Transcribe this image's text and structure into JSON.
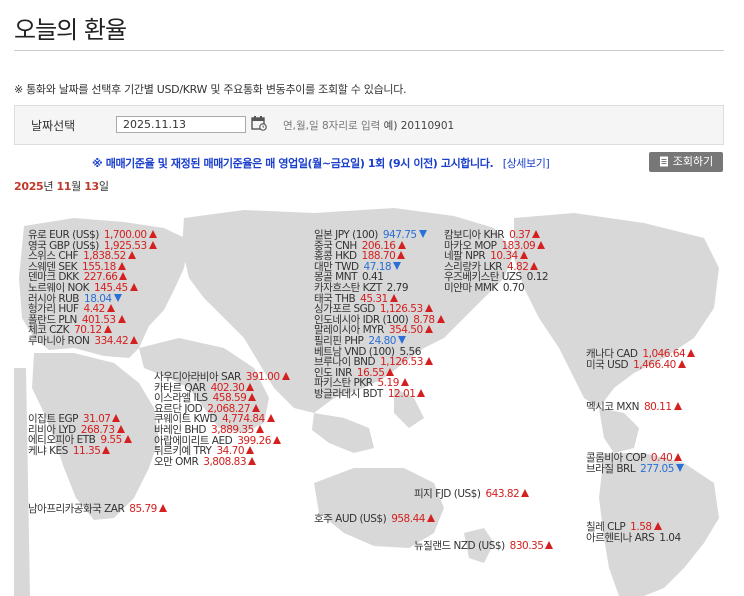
{
  "page_title": "오늘의 환율",
  "notice": "※ 통화와 날짜를 선택후 기간별 USD/KRW 및 주요통화 변동추이를 조회할 수 있습니다.",
  "search": {
    "label": "날짜선택",
    "date_value": "2025.11.13",
    "hint": "연,월,일 8자리로 입력",
    "example": "예) 20110901"
  },
  "blue_note": "※ 매매기준율 및 재정된 매매기준율은 매 영업일(월~금요일) 1회 (9시 이전) 고시합니다.",
  "detail_link": "[상세보기]",
  "lookup_button": "조회하기",
  "date_heading": {
    "year": "2025",
    "year_unit": "년",
    "month": "11",
    "month_unit": "월",
    "day": "13",
    "day_unit": "일"
  },
  "colors": {
    "up": "#d42020",
    "down": "#2a6fd6",
    "map": "#d8d8d8"
  },
  "groups": {
    "europe": [
      {
        "name": "유로 EUR (US$)",
        "value": "1,700.00",
        "dir": "up"
      },
      {
        "name": "영국 GBP (US$)",
        "value": "1,925.53",
        "dir": "up"
      },
      {
        "name": "스위스 CHF",
        "value": "1,838.52",
        "dir": "up"
      },
      {
        "name": "스웨덴 SEK",
        "value": "155.18",
        "dir": "up"
      },
      {
        "name": "덴마크 DKK",
        "value": "227.66",
        "dir": "up"
      },
      {
        "name": "노르웨이 NOK",
        "value": "145.45",
        "dir": "up"
      },
      {
        "name": "러시아 RUB",
        "value": "18.04",
        "dir": "down"
      },
      {
        "name": "헝가리 HUF",
        "value": "4.42",
        "dir": "up"
      },
      {
        "name": "폴란드 PLN",
        "value": "401.53",
        "dir": "up"
      },
      {
        "name": "체코 CZK",
        "value": "70.12",
        "dir": "up"
      },
      {
        "name": "루마니아 RON",
        "value": "334.42",
        "dir": "up"
      }
    ],
    "africa": [
      {
        "name": "이집트 EGP",
        "value": "31.07",
        "dir": "up"
      },
      {
        "name": "리비아 LYD",
        "value": "268.73",
        "dir": "up"
      },
      {
        "name": "에티오피아 ETB",
        "value": "9.55",
        "dir": "up"
      },
      {
        "name": "케냐 KES",
        "value": "11.35",
        "dir": "up"
      }
    ],
    "south_africa": [
      {
        "name": "남아프리카공화국 ZAR",
        "value": "85.79",
        "dir": "up"
      }
    ],
    "middle_east": [
      {
        "name": "사우디아라비아 SAR",
        "value": "391.00",
        "dir": "up"
      },
      {
        "name": "카타르 QAR",
        "value": "402.30",
        "dir": "up"
      },
      {
        "name": "이스라엘 ILS",
        "value": "458.59",
        "dir": "up"
      },
      {
        "name": "요르단 JOD",
        "value": "2,068.27",
        "dir": "up"
      },
      {
        "name": "쿠웨이트 KWD",
        "value": "4,774.84",
        "dir": "up"
      },
      {
        "name": "바레인 BHD",
        "value": "3,889.35",
        "dir": "up"
      },
      {
        "name": "아랍에미리트 AED",
        "value": "399.26",
        "dir": "up"
      },
      {
        "name": "튀르키예 TRY",
        "value": "34.70",
        "dir": "up"
      },
      {
        "name": "오만 OMR",
        "value": "3,808.83",
        "dir": "up"
      }
    ],
    "east_asia": [
      {
        "name": "일본 JPY (100)",
        "value": "947.75",
        "dir": "down"
      },
      {
        "name": "중국 CNH",
        "value": "206.16",
        "dir": "up"
      },
      {
        "name": "홍콩 HKD",
        "value": "188.70",
        "dir": "up"
      },
      {
        "name": "대만 TWD",
        "value": "47.18",
        "dir": "down"
      },
      {
        "name": "몽골 MNT",
        "value": "0.41",
        "dir": "flat"
      },
      {
        "name": "카자흐스탄 KZT",
        "value": "2.79",
        "dir": "flat"
      },
      {
        "name": "태국 THB",
        "value": "45.31",
        "dir": "up"
      },
      {
        "name": "싱가포르 SGD",
        "value": "1,126.53",
        "dir": "up"
      },
      {
        "name": "인도네시아 IDR (100)",
        "value": "8.78",
        "dir": "up"
      },
      {
        "name": "말레이시아 MYR",
        "value": "354.50",
        "dir": "up"
      },
      {
        "name": "필리핀 PHP",
        "value": "24.80",
        "dir": "down"
      },
      {
        "name": "베트남 VND (100)",
        "value": "5.56",
        "dir": "flat"
      },
      {
        "name": "브루나이 BND",
        "value": "1,126.53",
        "dir": "up"
      },
      {
        "name": "인도 INR",
        "value": "16.55",
        "dir": "up"
      },
      {
        "name": "파키스탄 PKR",
        "value": "5.19",
        "dir": "up"
      },
      {
        "name": "방글라데시 BDT",
        "value": "12.01",
        "dir": "up"
      }
    ],
    "south_asia": [
      {
        "name": "캄보디아 KHR",
        "value": "0.37",
        "dir": "up"
      },
      {
        "name": "마카오 MOP",
        "value": "183.09",
        "dir": "up"
      },
      {
        "name": "네팔 NPR",
        "value": "10.34",
        "dir": "up"
      },
      {
        "name": "스리랑카 LKR",
        "value": "4.82",
        "dir": "up"
      },
      {
        "name": "우즈베키스탄 UZS",
        "value": "0.12",
        "dir": "flat"
      },
      {
        "name": "미얀마 MMK",
        "value": "0.70",
        "dir": "flat"
      }
    ],
    "north_america": [
      {
        "name": "캐나다 CAD",
        "value": "1,046.64",
        "dir": "up"
      },
      {
        "name": "미국 USD",
        "value": "1,466.40",
        "dir": "up"
      }
    ],
    "mexico": [
      {
        "name": "멕시코 MXN",
        "value": "80.11",
        "dir": "up"
      }
    ],
    "south_america": [
      {
        "name": "콜롬비아 COP",
        "value": "0.40",
        "dir": "up"
      },
      {
        "name": "브라질 BRL",
        "value": "277.05",
        "dir": "down"
      }
    ],
    "fiji": [
      {
        "name": "피지 FJD (US$)",
        "value": "643.82",
        "dir": "up"
      }
    ],
    "australia": [
      {
        "name": "호주 AUD (US$)",
        "value": "958.44",
        "dir": "up"
      }
    ],
    "new_zealand": [
      {
        "name": "뉴질랜드 NZD (US$)",
        "value": "830.35",
        "dir": "up"
      }
    ],
    "chile": [
      {
        "name": "칠레 CLP",
        "value": "1.58",
        "dir": "up"
      },
      {
        "name": "아르헨티나 ARS",
        "value": "1.04",
        "dir": "flat"
      }
    ]
  }
}
